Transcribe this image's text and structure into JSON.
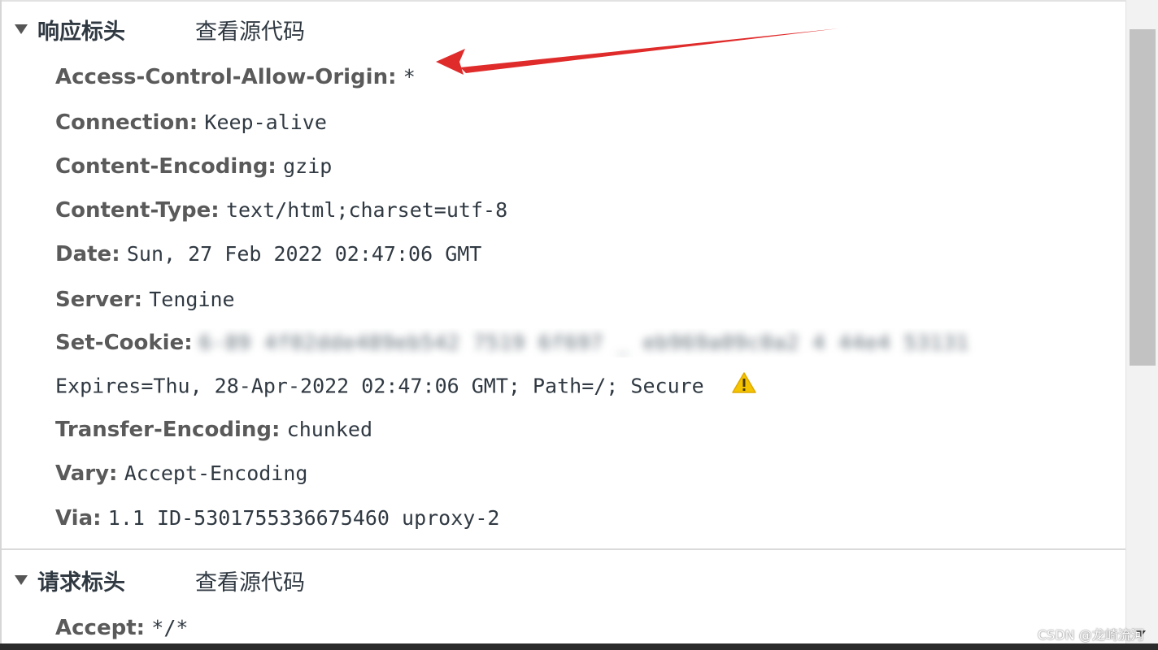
{
  "response_section": {
    "title": "响应标头",
    "view_source": "查看源代码",
    "headers": [
      {
        "name": "Access-Control-Allow-Origin:",
        "value": "*"
      },
      {
        "name": "Connection:",
        "value": "Keep-alive"
      },
      {
        "name": "Content-Encoding:",
        "value": "gzip"
      },
      {
        "name": "Content-Type:",
        "value": "text/html;charset=utf-8"
      },
      {
        "name": "Date:",
        "value": "Sun, 27 Feb 2022 02:47:06 GMT"
      },
      {
        "name": "Server:",
        "value": "Tengine"
      },
      {
        "name": "Set-Cookie:",
        "value": "6-89 4f02dde489eb542 7519 6f697 _ eb969a09c0a2 4 44e4 53131"
      },
      {
        "name": "",
        "value": "Expires=Thu, 28-Apr-2022 02:47:06 GMT; Path=/; Secure"
      },
      {
        "name": "Transfer-Encoding:",
        "value": "chunked"
      },
      {
        "name": "Vary:",
        "value": "Accept-Encoding"
      },
      {
        "name": "Via:",
        "value": "1.1 ID-5301755336675460 uproxy-2"
      }
    ]
  },
  "request_section": {
    "title": "请求标头",
    "view_source": "查看源代码",
    "headers": [
      {
        "name": "Accept:",
        "value": "*/*"
      }
    ]
  },
  "icons": {
    "expand": "triangle-down-icon",
    "warning": "warning-icon",
    "warning_color": "#f5c400"
  },
  "annotation": {
    "arrow_color": "#e02b2b"
  },
  "watermark": "CSDN @龙崎流河"
}
